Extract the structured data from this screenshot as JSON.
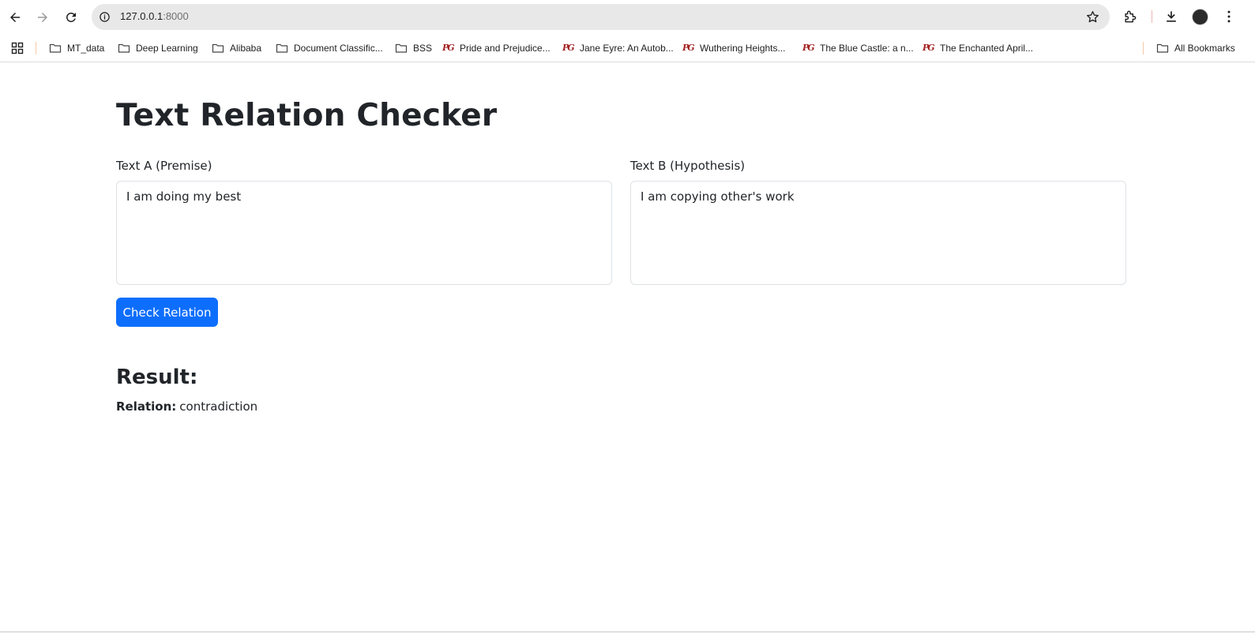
{
  "browser": {
    "url_host": "127.0.0.1",
    "url_port": ":8000",
    "icons": {
      "back": "arrow-left-icon",
      "forward": "arrow-right-icon",
      "reload": "reload-icon",
      "site_info": "info-icon",
      "bookmark": "star-icon",
      "extensions": "puzzle-icon",
      "downloads": "download-icon",
      "menu": "kebab-menu-icon"
    }
  },
  "bookmarks": {
    "items": [
      {
        "label": "MT_data",
        "icon": "folder-icon"
      },
      {
        "label": "Deep Learning",
        "icon": "folder-icon"
      },
      {
        "label": "Alibaba",
        "icon": "folder-icon"
      },
      {
        "label": "Document Classific...",
        "icon": "folder-icon"
      },
      {
        "label": "BSS",
        "icon": "folder-icon"
      },
      {
        "label": "Pride and Prejudice...",
        "icon": "pg-icon"
      },
      {
        "label": "Jane Eyre: An Autob...",
        "icon": "pg-icon"
      },
      {
        "label": "Wuthering Heights...",
        "icon": "pg-icon"
      },
      {
        "label": "The Blue Castle: a n...",
        "icon": "pg-icon"
      },
      {
        "label": "The Enchanted April...",
        "icon": "pg-icon"
      }
    ],
    "all_bookmarks": "All Bookmarks"
  },
  "page": {
    "title": "Text Relation Checker",
    "text_a": {
      "label": "Text A (Premise)",
      "value": "I am doing my best"
    },
    "text_b": {
      "label": "Text B (Hypothesis)",
      "value": "I am copying other's work"
    },
    "check_button": "Check Relation",
    "result": {
      "heading": "Result:",
      "relation_label": "Relation:",
      "relation_value": "contradiction"
    }
  },
  "colors": {
    "primary_button": "#0d6efd",
    "text": "#212529"
  }
}
